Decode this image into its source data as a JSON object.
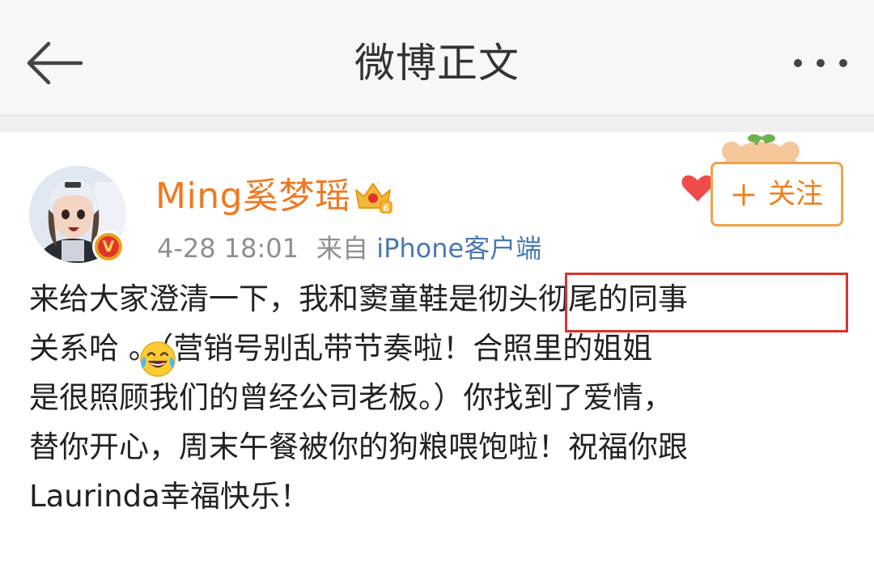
{
  "header": {
    "title": "微博正文",
    "back_icon": "arrow-left-icon",
    "more_icon": "ellipsis-icon"
  },
  "post": {
    "author": {
      "name": "Ming奚梦瑶",
      "verified_badge": "V",
      "level_icon": "crown-vip-icon",
      "verified_color": "#e1342d",
      "name_color": "#f0781f"
    },
    "meta": {
      "time": "4-28 18:01",
      "from_prefix": "来自",
      "source": "iPhone客户端"
    },
    "follow_button": {
      "label": "关注",
      "icon": "plus-icon",
      "accent": "#f0a24a"
    },
    "lines": [
      "来给大家澄清一下，我和窦童鞋是彻头彻尾的同事",
      "关系哈   。（营销号别乱带节奏啦！合照里的姐姐",
      "是很照顾我们的曾经公司老板。）你找到了爱情，",
      "替你开心，周末午餐被你的狗粮喂饱啦！祝福你跟",
      "Laurinda幸福快乐！"
    ],
    "emoji_icon": "laughing-tears-emoji",
    "highlight_color": "#d9332b"
  }
}
